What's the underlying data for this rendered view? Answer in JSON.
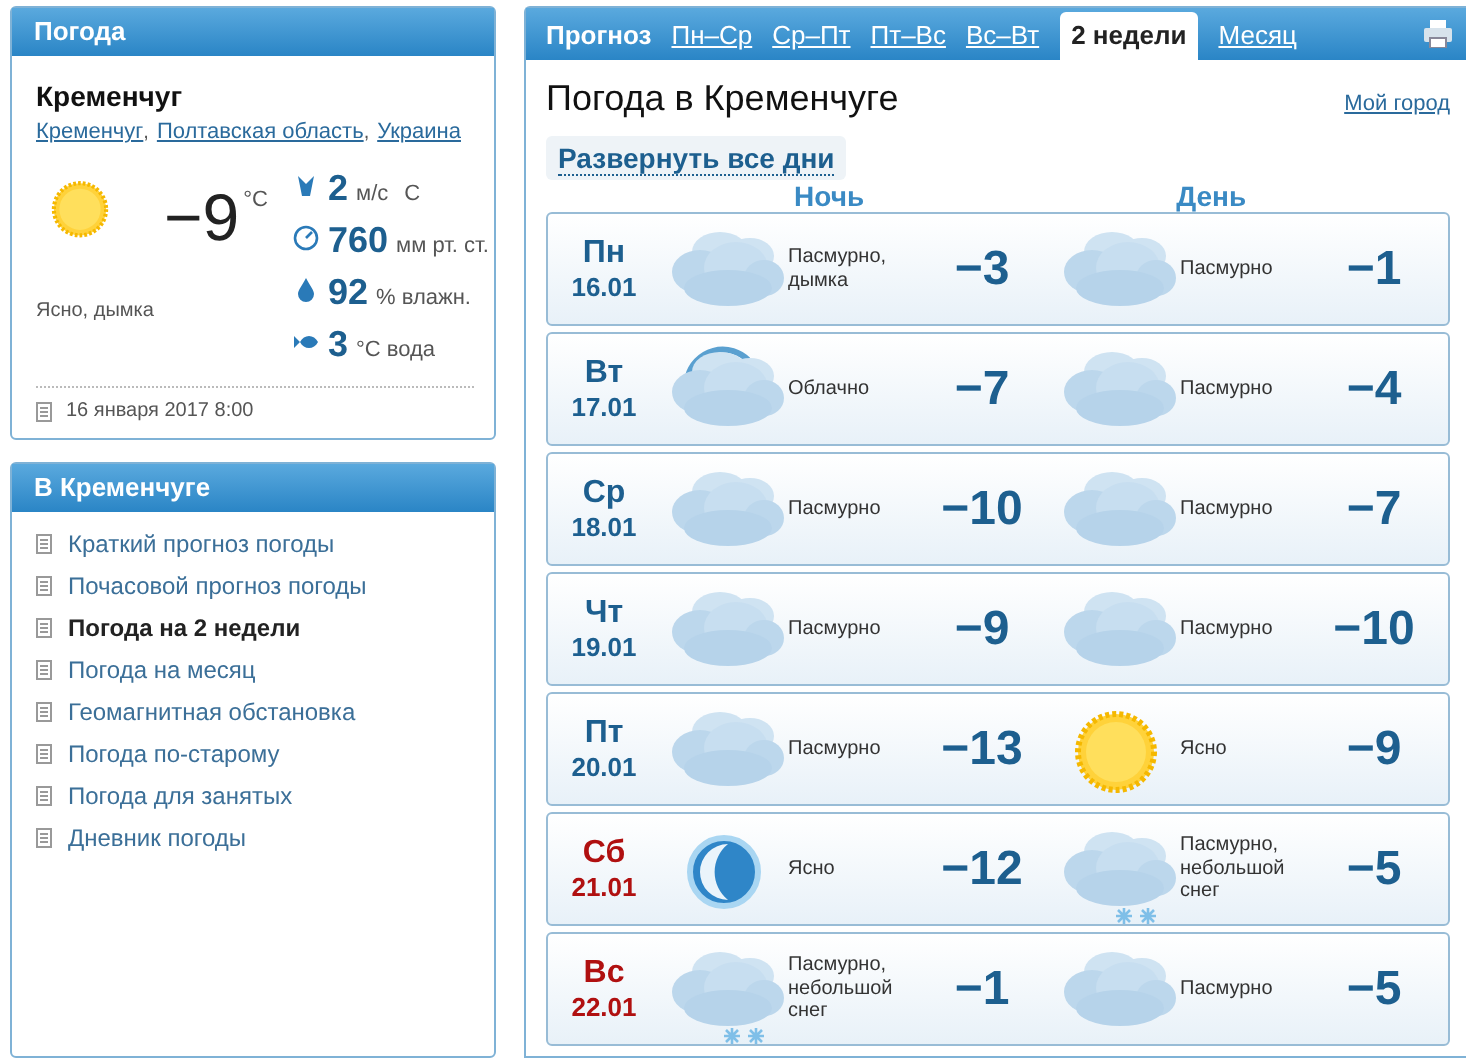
{
  "current": {
    "title": "Погода",
    "city": "Кременчуг",
    "breadcrumbs": [
      "Кременчуг",
      "Полтавская область",
      "Украина"
    ],
    "breadcrumb_separator": ",",
    "kind": "clear_day",
    "temp": "−9",
    "unit": "°C",
    "description": "Ясно, дымка",
    "stats": [
      {
        "kind": "wind",
        "value": "2",
        "unit": "м/с",
        "extra": "С"
      },
      {
        "kind": "pressure",
        "value": "760",
        "unit": "мм рт. ст."
      },
      {
        "kind": "humidity",
        "value": "92",
        "unit": "% влажн."
      },
      {
        "kind": "water",
        "value": "3",
        "unit": "°C вода"
      }
    ],
    "updated": "16 января 2017 8:00"
  },
  "links": {
    "title": "В Кременчуге",
    "items": [
      {
        "label": "Краткий прогноз погоды",
        "selected": false
      },
      {
        "label": "Почасовой прогноз погоды",
        "selected": false
      },
      {
        "label": "Погода на 2 недели",
        "selected": true
      },
      {
        "label": "Погода на месяц",
        "selected": false
      },
      {
        "label": "Геомагнитная обстановка",
        "selected": false
      },
      {
        "label": "Погода по-старому",
        "selected": false
      },
      {
        "label": "Погода для занятых",
        "selected": false
      },
      {
        "label": "Дневник погоды",
        "selected": false
      }
    ]
  },
  "forecast": {
    "tabs_label": "Прогноз",
    "tabs": [
      {
        "label": "Пн–Ср",
        "selected": false
      },
      {
        "label": "Ср–Пт",
        "selected": false
      },
      {
        "label": "Пт–Вс",
        "selected": false
      },
      {
        "label": "Вс–Вт",
        "selected": false
      },
      {
        "label": "2 недели",
        "selected": true
      },
      {
        "label": "Месяц",
        "selected": false
      }
    ],
    "title": "Погода в Кременчуге",
    "my_city": "Мой город",
    "expand": "Развернуть все дни",
    "night_label": "Ночь",
    "day_label": "День",
    "days": [
      {
        "weekday": "Пн",
        "date": "16.01",
        "weekend": false,
        "night": {
          "kind": "overcast",
          "text": "Пасмурно, дымка",
          "temp": "−3"
        },
        "day": {
          "kind": "overcast",
          "text": "Пасмурно",
          "temp": "−1"
        }
      },
      {
        "weekday": "Вт",
        "date": "17.01",
        "weekend": false,
        "night": {
          "kind": "cloudy_night",
          "text": "Облачно",
          "temp": "−7"
        },
        "day": {
          "kind": "overcast",
          "text": "Пасмурно",
          "temp": "−4"
        }
      },
      {
        "weekday": "Ср",
        "date": "18.01",
        "weekend": false,
        "night": {
          "kind": "overcast",
          "text": "Пасмурно",
          "temp": "−10"
        },
        "day": {
          "kind": "overcast",
          "text": "Пасмурно",
          "temp": "−7"
        }
      },
      {
        "weekday": "Чт",
        "date": "19.01",
        "weekend": false,
        "night": {
          "kind": "overcast",
          "text": "Пасмурно",
          "temp": "−9"
        },
        "day": {
          "kind": "overcast",
          "text": "Пасмурно",
          "temp": "−10"
        }
      },
      {
        "weekday": "Пт",
        "date": "20.01",
        "weekend": false,
        "night": {
          "kind": "overcast",
          "text": "Пасмурно",
          "temp": "−13"
        },
        "day": {
          "kind": "clear_day",
          "text": "Ясно",
          "temp": "−9"
        }
      },
      {
        "weekday": "Сб",
        "date": "21.01",
        "weekend": true,
        "night": {
          "kind": "clear_night",
          "text": "Ясно",
          "temp": "−12"
        },
        "day": {
          "kind": "overcast_snow",
          "text": "Пасмурно, небольшой снег",
          "temp": "−5"
        }
      },
      {
        "weekday": "Вс",
        "date": "22.01",
        "weekend": true,
        "night": {
          "kind": "overcast_snow",
          "text": "Пасмурно, небольшой снег",
          "temp": "−1"
        },
        "day": {
          "kind": "overcast",
          "text": "Пасмурно",
          "temp": "−5"
        }
      }
    ]
  }
}
